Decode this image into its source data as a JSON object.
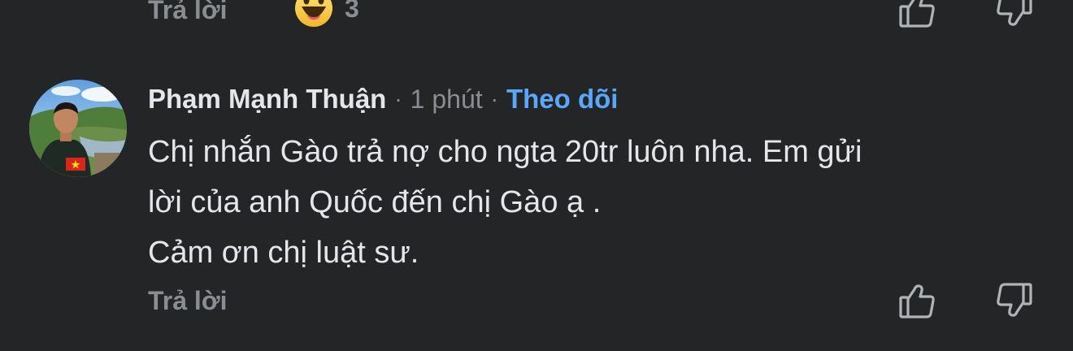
{
  "previous_comment": {
    "reply_label": "Trả lời",
    "reaction_icon": "haha-emoji-icon",
    "reaction_count": "3",
    "like_icon": "thumbs-up-icon",
    "dislike_icon": "thumbs-down-icon"
  },
  "comment": {
    "author": "Phạm Mạnh Thuận",
    "separator": "·",
    "time": "1 phút",
    "follow_label": "Theo dõi",
    "avatar_badge": "vietnam-flag-icon",
    "lines": [
      "Chị nhắn Gào trả nợ cho ngta 20tr luôn nha. Em gửi",
      "lời của anh Quốc đến chị Gào ạ .",
      "Cảm ơn chị luật sư."
    ],
    "reply_label": "Trả lời",
    "like_icon": "thumbs-up-icon",
    "dislike_icon": "thumbs-down-icon"
  },
  "colors": {
    "background": "#242526",
    "primary_text": "#e4e6eb",
    "secondary_text": "#8a8d91",
    "link": "#5aa7ff"
  }
}
